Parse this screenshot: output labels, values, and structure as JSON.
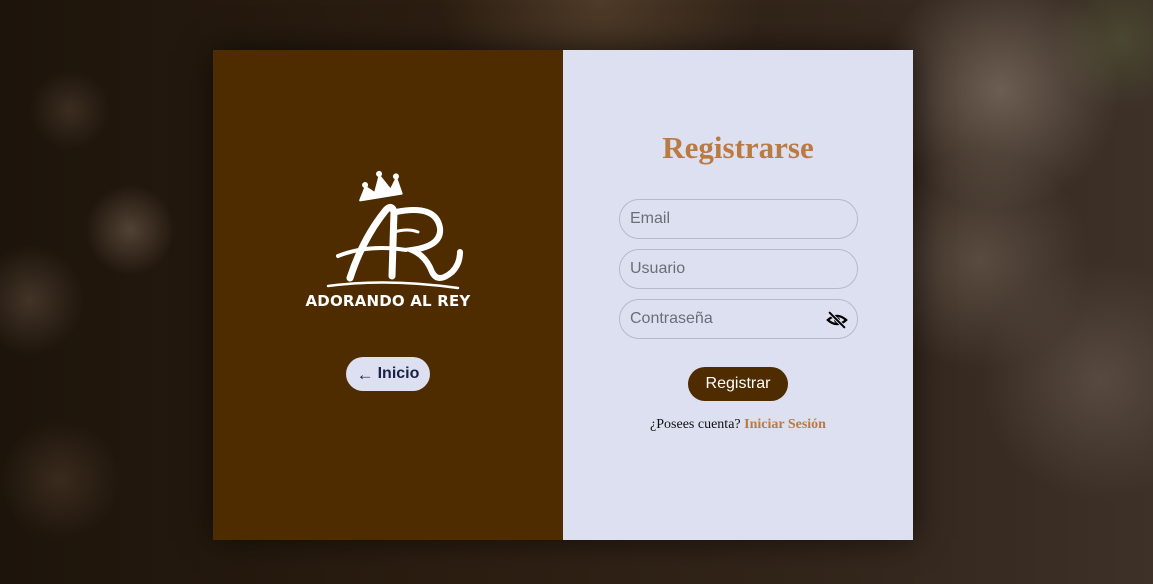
{
  "brand": {
    "name": "ADORANDO AL REY",
    "logo_icon": "crown-ar-monogram-icon",
    "panel_color": "#4e2c00"
  },
  "nav": {
    "back_label": "Inicio",
    "back_icon": "arrow-left-icon"
  },
  "form": {
    "title": "Registrarse",
    "email_placeholder": "Email",
    "username_placeholder": "Usuario",
    "password_placeholder": "Contraseña",
    "password_toggle_icon": "eye-slash-icon",
    "submit_label": "Registrar",
    "account_prompt": "¿Posees cuenta?",
    "login_link": "Iniciar Sesión",
    "accent_color": "#b97b43",
    "background_color": "#dde0f0"
  }
}
